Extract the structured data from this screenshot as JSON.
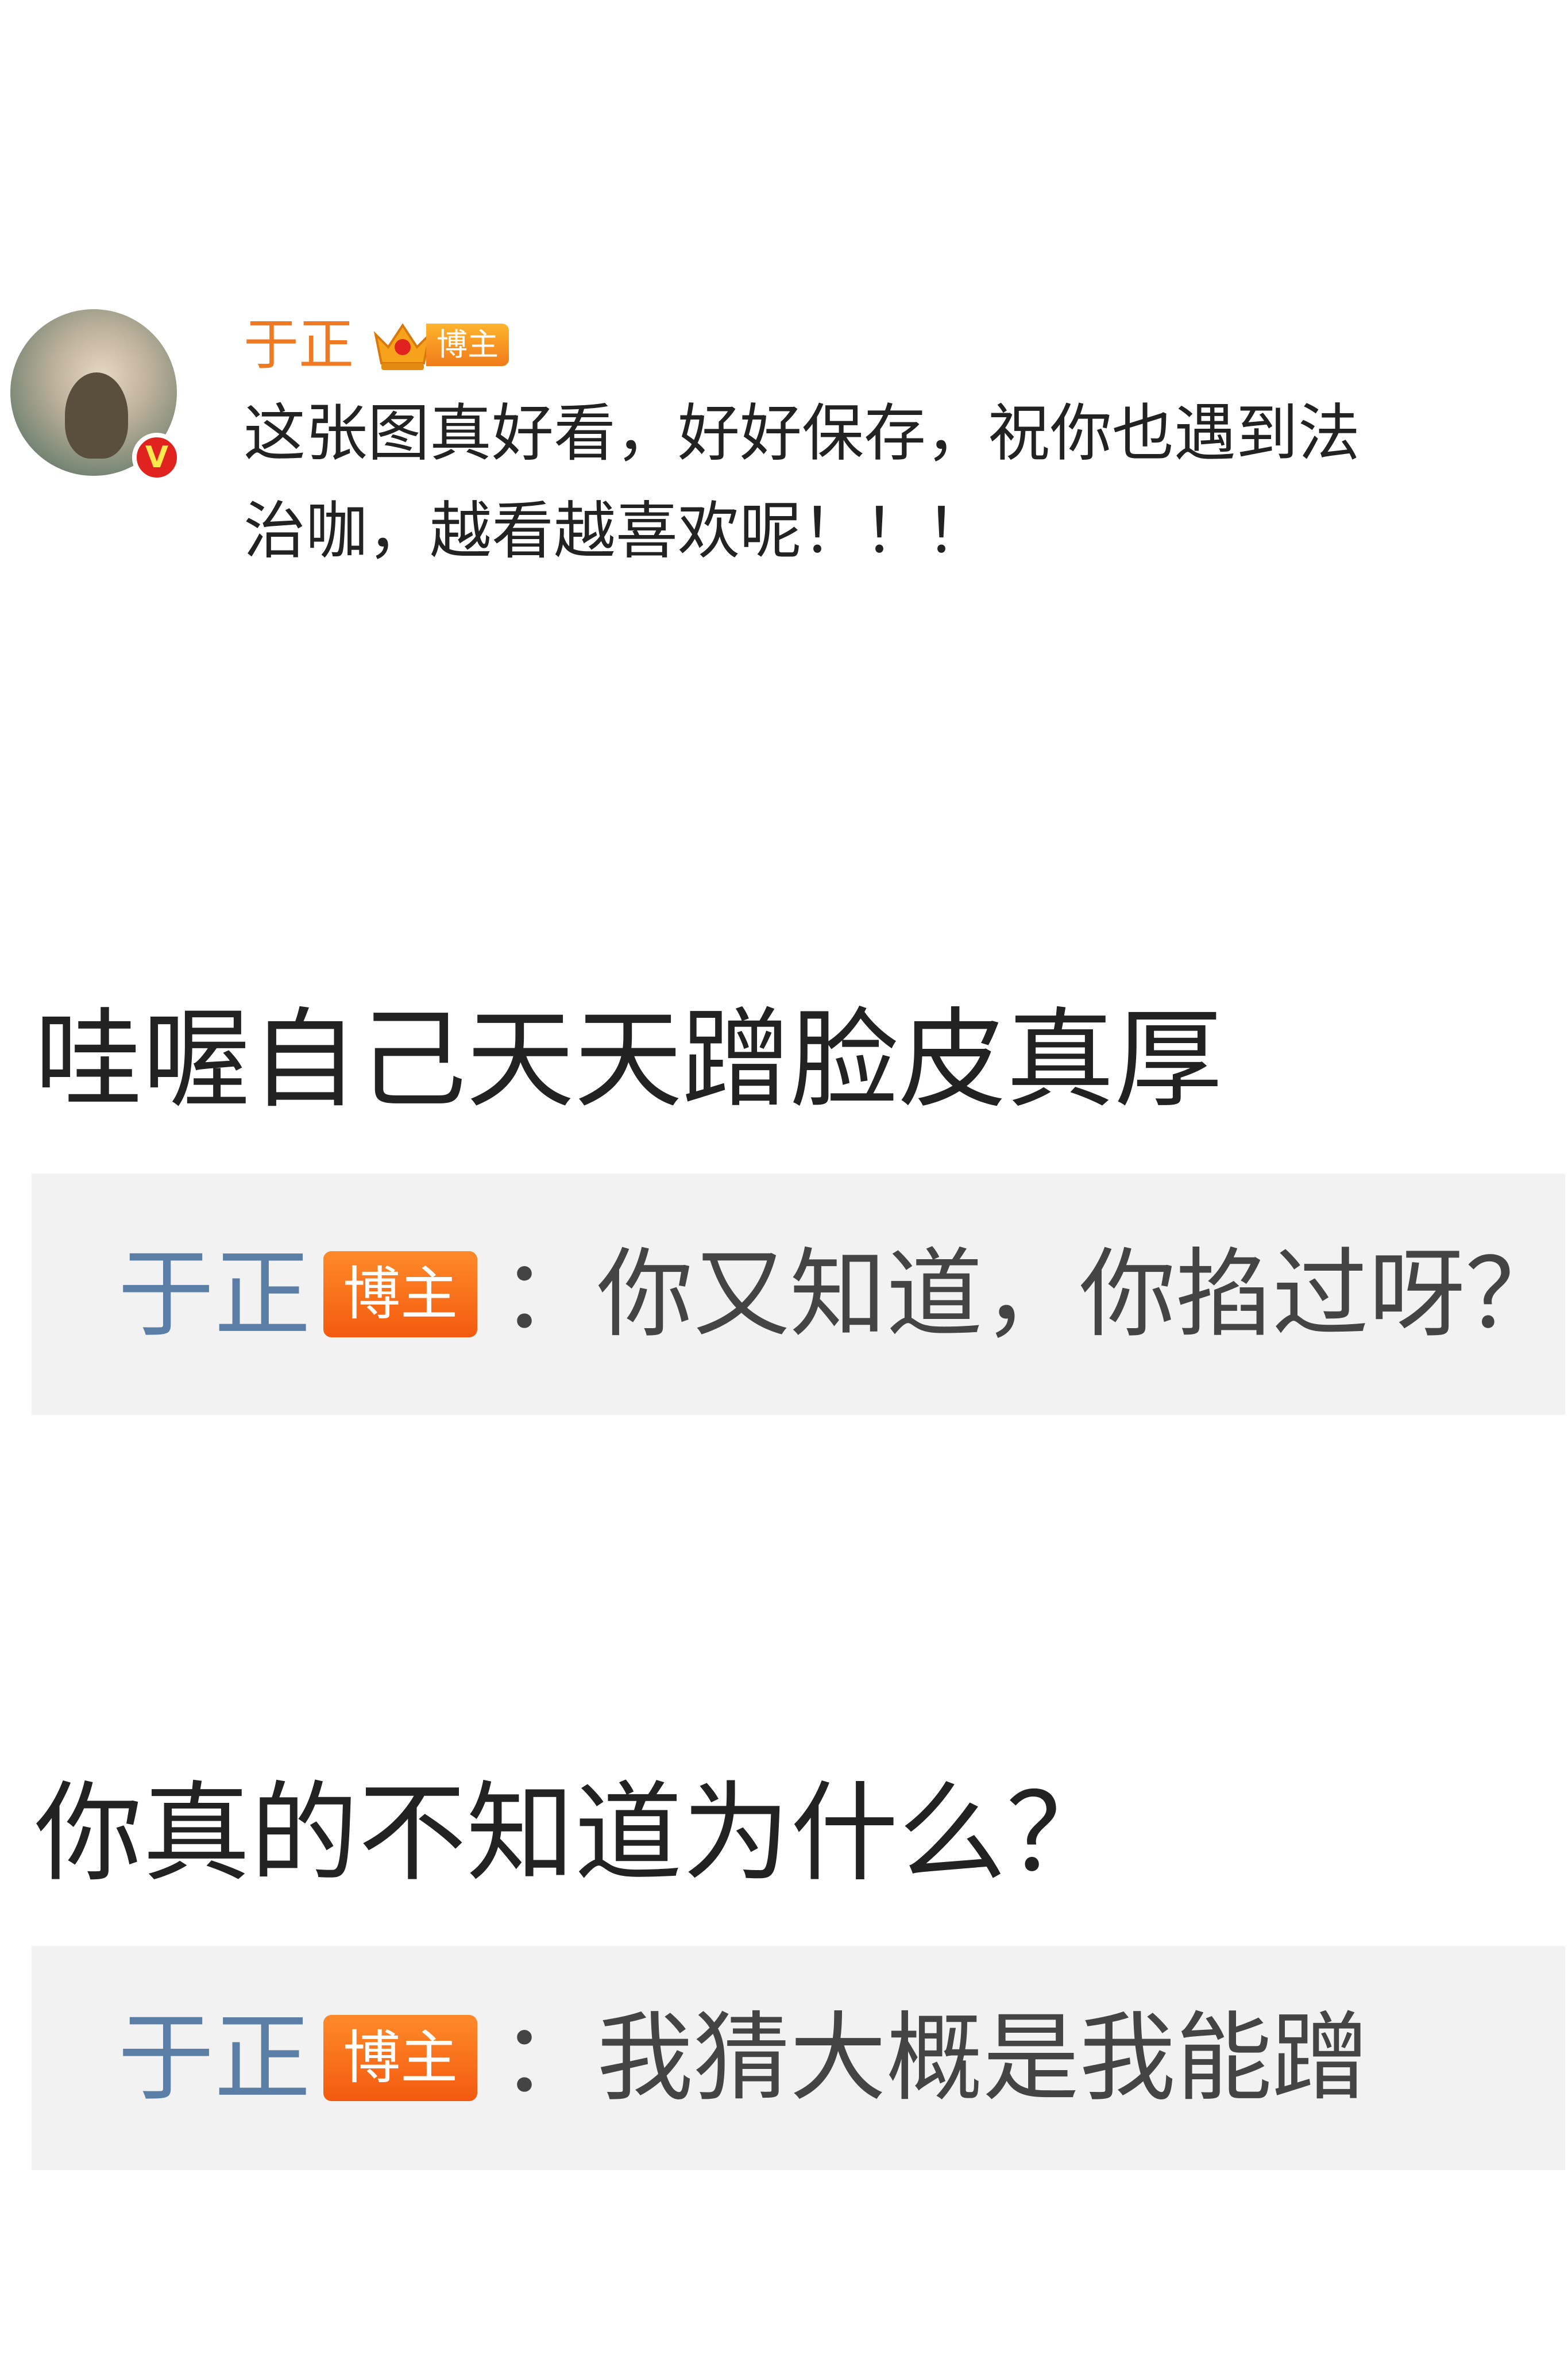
{
  "post": {
    "author": "于正",
    "badge": "博主",
    "verified_mark": "V",
    "text_lines": [
      "这张图真好看，好好保存，祝你也遇到法",
      "治咖，越看越喜欢呢！！！"
    ]
  },
  "comments": [
    {
      "text": "哇喔自己天天蹭脸皮真厚",
      "reply": {
        "author": "于正",
        "badge": "博主",
        "text": "：你又知道，你掐过呀？"
      }
    },
    {
      "text": "你真的不知道为什么？",
      "reply": {
        "author": "于正",
        "badge": "博主",
        "text": "：我猜大概是我能蹭"
      }
    }
  ],
  "colors": {
    "author_orange": "#f07a22",
    "reply_author_blue": "#5b7ea6",
    "badge_orange": "#f35a0f",
    "reply_bg": "#f2f2f2",
    "verified_red": "#e0231f"
  },
  "icons": [
    "crown-icon",
    "verified-v-icon"
  ]
}
